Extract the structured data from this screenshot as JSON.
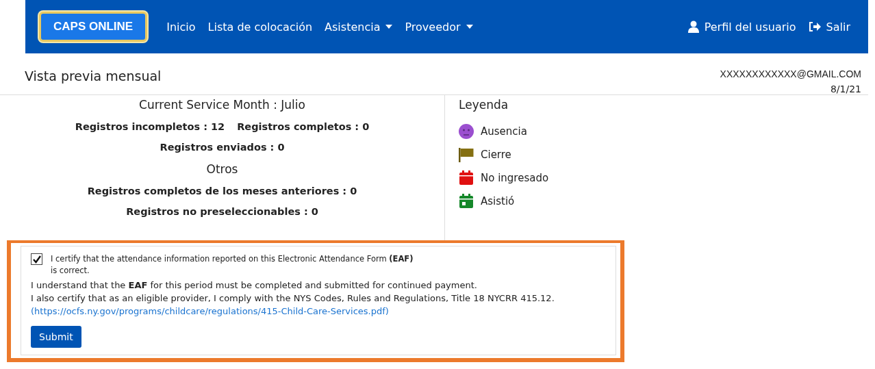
{
  "navbar": {
    "logo": "CAPS ONLINE",
    "items": [
      {
        "label": "Inicio",
        "dropdown": false
      },
      {
        "label": "Lista de colocación",
        "dropdown": false
      },
      {
        "label": "Asistencia",
        "dropdown": true
      },
      {
        "label": "Proveedor",
        "dropdown": true
      }
    ],
    "right": [
      {
        "kind": "user",
        "label": "Perfil del usuario"
      },
      {
        "kind": "logout",
        "label": "Salir"
      }
    ]
  },
  "page_title": "Vista previa mensual",
  "account": {
    "email": "XXXXXXXXXXXX@GMAIL.COM",
    "date": "8/1/21"
  },
  "summary": [
    {
      "kind": "heading",
      "texts": [
        "Current Service Month : Julio"
      ]
    },
    {
      "kind": "stat",
      "texts": [
        "Registros incompletos : 12",
        "Registros completos : 0"
      ]
    },
    {
      "kind": "stat",
      "texts": [
        "Registros enviados : 0"
      ]
    },
    {
      "kind": "heading",
      "texts": [
        "Otros"
      ]
    },
    {
      "kind": "stat",
      "texts": [
        "Registros completos de los meses anteriores : 0"
      ]
    },
    {
      "kind": "stat",
      "texts": [
        "Registros no preseleccionables : 0"
      ]
    }
  ],
  "legend": {
    "title": "Leyenda",
    "items": [
      {
        "kind": "absence",
        "label": "Ausencia"
      },
      {
        "kind": "closure",
        "label": "Cierre"
      },
      {
        "kind": "not-entered",
        "label": "No ingresado"
      },
      {
        "kind": "attended",
        "label": "Asistió"
      }
    ]
  },
  "certification": {
    "checked": true,
    "statement": "I certify that the attendance information reported on this Electronic Attendance Form **(EAF)** is correct.",
    "paragraphs": [
      "I understand that the **EAF** for this period must be completed and submitted for continued payment.",
      "I also certify that as an eligible provider, I comply with the NYS Codes, Rules and Regulations, Title 18 NYCRR 415.12."
    ],
    "link": "(https://ocfs.ny.gov/programs/childcare/regulations/415-Child-Care-Services.pdf)",
    "button": "Submit"
  }
}
